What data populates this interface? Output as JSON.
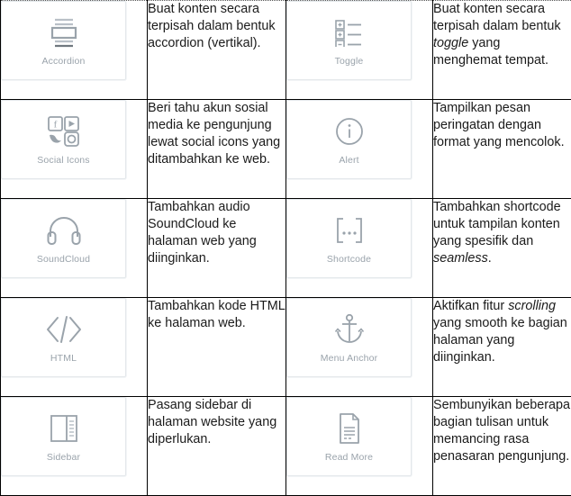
{
  "table": {
    "colors": {
      "grid_border": "#000000",
      "card_border": "#e4e8eb",
      "icon_color": "#9aa3ab",
      "label_color": "#9aa3ab",
      "text_color": "#1b1b1b"
    },
    "rows": [
      {
        "left": {
          "icon": "accordion-icon",
          "label": "Accordion",
          "desc_html": "Buat konten secara terpisah dalam bentuk accordion (vertikal)."
        },
        "right": {
          "icon": "toggle-icon",
          "label": "Toggle",
          "desc_html": "Buat konten secara terpisah dalam bentuk <i>toggle</i> yang menghemat tempat."
        }
      },
      {
        "left": {
          "icon": "social-icons-icon",
          "label": "Social Icons",
          "desc_html": "Beri tahu akun sosial media ke pengunjung lewat social icons yang ditambahkan ke web."
        },
        "right": {
          "icon": "alert-icon",
          "label": "Alert",
          "desc_html": "Tampilkan pesan peringatan dengan format yang mencolok."
        }
      },
      {
        "left": {
          "icon": "soundcloud-icon",
          "label": "SoundCloud",
          "desc_html": "Tambahkan audio SoundCloud ke halaman web yang diinginkan."
        },
        "right": {
          "icon": "shortcode-icon",
          "label": "Shortcode",
          "desc_html": "Tambahkan shortcode untuk tampilan konten yang spesifik dan <i>seamless</i>."
        }
      },
      {
        "left": {
          "icon": "html-code-icon",
          "label": "HTML",
          "desc_html": "Tambahkan kode HTML ke halaman web."
        },
        "right": {
          "icon": "menu-anchor-icon",
          "label": "Menu Anchor",
          "desc_html": "Aktifkan fitur <i>scrolling</i> yang smooth ke bagian halaman yang diinginkan."
        }
      },
      {
        "left": {
          "icon": "sidebar-icon",
          "label": "Sidebar",
          "desc_html": "Pasang sidebar di halaman website yang diperlukan."
        },
        "right": {
          "icon": "read-more-icon",
          "label": "Read More",
          "desc_html": "Sembunyikan beberapa bagian tulisan untuk memancing rasa penasaran pengunjung."
        }
      }
    ]
  }
}
